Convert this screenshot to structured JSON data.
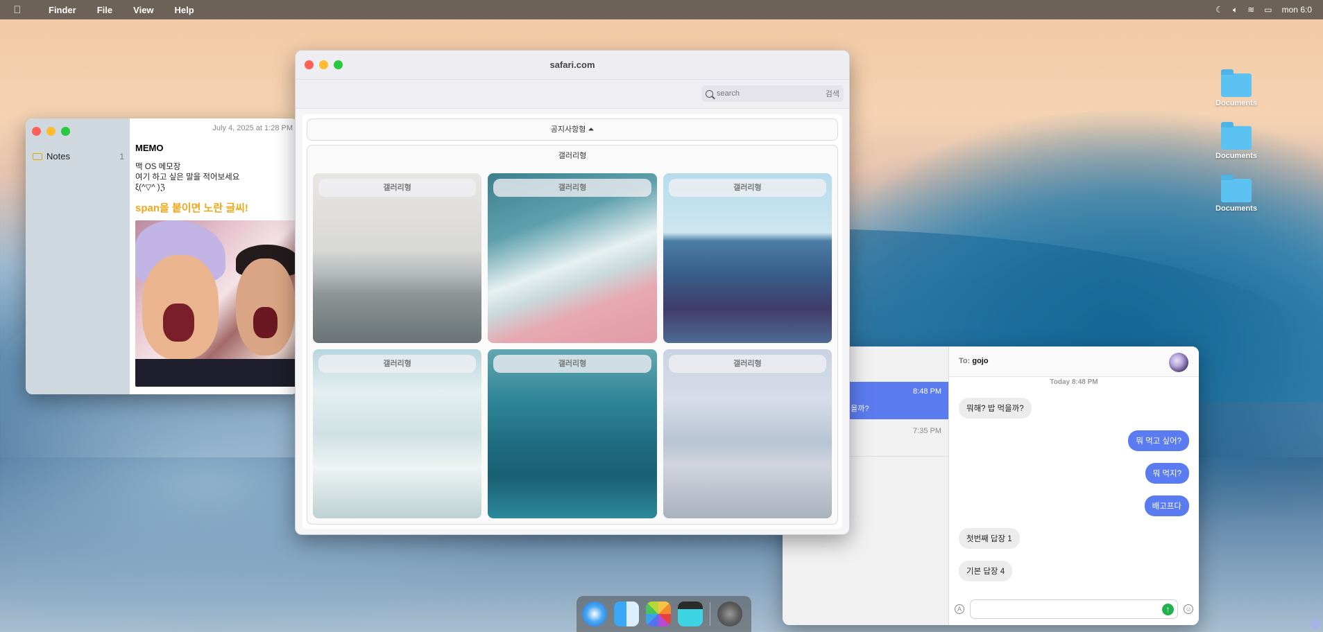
{
  "menubar": {
    "apple_icon": "apple-icon",
    "items": [
      "Finder",
      "File",
      "View",
      "Help"
    ],
    "status_icons": [
      "moon-icon",
      "volume-icon",
      "wifi-icon",
      "battery-icon"
    ],
    "clock": "mon 6:0"
  },
  "desktop": {
    "icons": [
      {
        "label": "Documents",
        "icon": "folder-icon"
      },
      {
        "label": "Documents",
        "icon": "folder-icon"
      },
      {
        "label": "Documents",
        "icon": "folder-icon"
      }
    ]
  },
  "notes": {
    "sidebar": {
      "folder_label": "Notes",
      "count": "1"
    },
    "date": "July 4, 2025 at 1:28 PM",
    "title": "MEMO",
    "lines": [
      "맥 OS 메모장",
      "여기 하고 싶은 말을 적어보세요",
      "ξ(^▽^ )ℨ"
    ],
    "highlight": "span을 붙이면 노란 글씨!"
  },
  "safari": {
    "title": "safari.com",
    "search": {
      "placeholder": "search",
      "button": "검색"
    },
    "notice_label": "공지사항형 ⏶",
    "gallery_title": "갤러리형",
    "tiles": [
      {
        "caption": "갤러리형"
      },
      {
        "caption": "갤러리형"
      },
      {
        "caption": "갤러리형"
      },
      {
        "caption": "갤러리형"
      },
      {
        "caption": "갤러리형"
      },
      {
        "caption": "갤러리형"
      }
    ]
  },
  "messages": {
    "conversations": [
      {
        "time": "8:48 PM",
        "preview": "먹을까?"
      },
      {
        "time": "7:35 PM",
        "preview": ""
      }
    ],
    "to_prefix": "To:",
    "to_name": "gojo",
    "day_label": "Today 8:48 PM",
    "bubbles": [
      {
        "dir": "in",
        "text": "뭐해? 밥 먹을까?"
      },
      {
        "dir": "out",
        "text": "뭐 먹고 싶어?"
      },
      {
        "dir": "out",
        "text": "뭐 먹지?"
      },
      {
        "dir": "out",
        "text": "배고프다"
      },
      {
        "dir": "in",
        "text": "첫번째 답장 1"
      },
      {
        "dir": "in",
        "text": "기본 답장 4"
      }
    ],
    "composer": {
      "placeholder": "",
      "send_icon": "send-arrow-icon",
      "send_glyph": "↑"
    }
  },
  "dock": {
    "apps": [
      "safari-icon",
      "finder-icon",
      "photos-icon",
      "clips-icon",
      "system-settings-icon"
    ]
  }
}
